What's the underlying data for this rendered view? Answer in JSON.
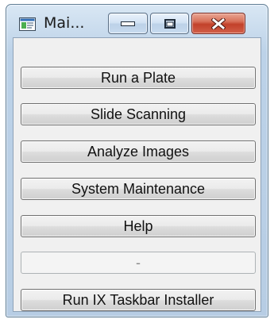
{
  "window": {
    "title": "Mai...",
    "icon": "app-window-icon",
    "controls": {
      "minimize_icon": "minimize-icon",
      "maximize_icon": "maximize-icon",
      "close_icon": "close-icon"
    }
  },
  "buttons": {
    "run_plate": "Run a Plate",
    "slide_scanning": "Slide Scanning",
    "analyze_images": "Analyze Images",
    "system_maintenance": "System Maintenance",
    "help": "Help",
    "disabled_placeholder": "-",
    "taskbar_installer": "Run IX Taskbar Installer"
  },
  "colors": {
    "close_button": "#c2412a",
    "title_frame": "#bcd2e8",
    "client_background": "#f0f0f0"
  }
}
